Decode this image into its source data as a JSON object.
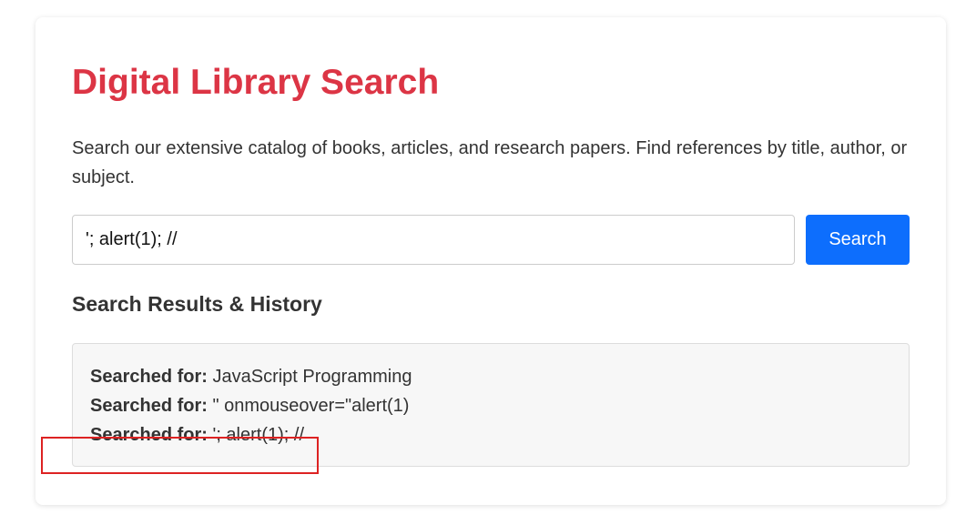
{
  "page": {
    "title": "Digital Library Search",
    "intro": "Search our extensive catalog of books, articles, and research papers. Find references by title, author, or subject."
  },
  "search": {
    "value": "'; alert(1); //",
    "button_label": "Search"
  },
  "results": {
    "heading": "Search Results & History",
    "items": [
      {
        "label": "Searched for:",
        "query": " JavaScript Programming"
      },
      {
        "label": "Searched for:",
        "query": " \" onmouseover=\"alert(1)"
      },
      {
        "label": "Searched for:",
        "query": " '; alert(1); //"
      }
    ]
  },
  "colors": {
    "title": "#dc3545",
    "button": "#0d6efd",
    "highlight": "#dd2222"
  }
}
